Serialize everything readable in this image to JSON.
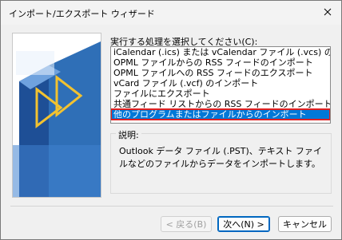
{
  "window": {
    "title": "インポート/エクスポート ウィザード"
  },
  "prompt": {
    "label": "実行する処理を選択してください(C):"
  },
  "actions": {
    "items": [
      {
        "label": "iCalendar (.ics) または vCalendar ファイル (.vcs) のインポート",
        "selected": false
      },
      {
        "label": "OPML ファイルからの RSS フィードのインポート",
        "selected": false
      },
      {
        "label": "OPML ファイルへの RSS フィードのエクスポート",
        "selected": false
      },
      {
        "label": "vCard ファイル (.vcf) のインポート",
        "selected": false
      },
      {
        "label": "ファイルにエクスポート",
        "selected": false
      },
      {
        "label": "共通フィード リストからの RSS フィードのインポート",
        "selected": false
      },
      {
        "label": "他のプログラムまたはファイルからのインポート",
        "selected": true
      }
    ]
  },
  "description": {
    "legend": "説明:",
    "text": "Outlook データ ファイル (.PST)、テキスト ファイルなどのファイルからデータをインポートします。"
  },
  "buttons": {
    "back": "< 戻る(B)",
    "next": "次へ(N) >",
    "cancel": "キャンセル"
  },
  "colors": {
    "selection": "#0078d7",
    "highlight_border": "#e02020",
    "art_blue": "#2f6fb7"
  }
}
